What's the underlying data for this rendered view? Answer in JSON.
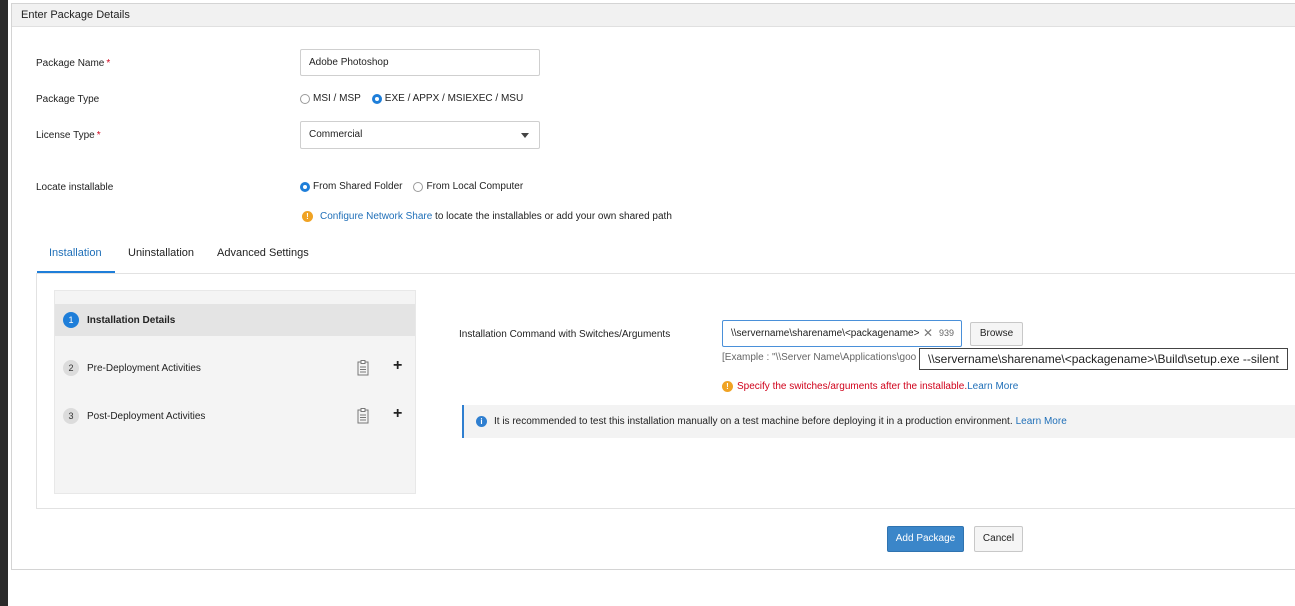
{
  "panel": {
    "title": "Enter Package Details"
  },
  "form": {
    "package_name": {
      "label": "Package Name",
      "required_mark": "*",
      "value": "Adobe Photoshop"
    },
    "package_type": {
      "label": "Package Type",
      "options": [
        {
          "label": "MSI / MSP",
          "checked": false
        },
        {
          "label": "EXE / APPX / MSIEXEC / MSU",
          "checked": true
        }
      ]
    },
    "license_type": {
      "label": "License Type",
      "required_mark": "*",
      "value": "Commercial"
    },
    "locate_installable": {
      "label": "Locate installable",
      "options": [
        {
          "label": "From Shared Folder",
          "checked": true
        },
        {
          "label": "From Local Computer",
          "checked": false
        }
      ],
      "hint_link": "Configure Network Share",
      "hint_text": " to locate the installables or add your own shared path"
    }
  },
  "tabs": [
    {
      "label": "Installation",
      "active": true
    },
    {
      "label": "Uninstallation",
      "active": false
    },
    {
      "label": "Advanced Settings",
      "active": false
    }
  ],
  "steps": [
    {
      "num": "1",
      "label": "Installation Details",
      "active": true
    },
    {
      "num": "2",
      "label": "Pre-Deployment Activities",
      "active": false
    },
    {
      "num": "3",
      "label": "Post-Deployment Activities",
      "active": false
    }
  ],
  "installation": {
    "command_label": "Installation Command with Switches/Arguments",
    "command_value": "\\\\servername\\sharename\\<packagename>",
    "char_count": "939",
    "browse_label": "Browse",
    "example_text": "[Example : \"\\\\Server Name\\Applications\\goo",
    "tooltip_text": "\\\\servername\\sharename\\<packagename>\\Build\\setup.exe --silent",
    "warning_text": "Specify the switches/arguments after the installable.",
    "warning_link": "Learn More",
    "info_text": "It is recommended to test this installation manually on a test machine before deploying it in a production environment.",
    "info_link": "Learn More"
  },
  "actions": {
    "add_label": "Add Package",
    "cancel_label": "Cancel"
  },
  "colors": {
    "accent": "#1e7ed9",
    "primary_button": "#3b86c9",
    "warning": "#f0a324",
    "error_text": "#d0021b",
    "link": "#1f6fb8"
  }
}
